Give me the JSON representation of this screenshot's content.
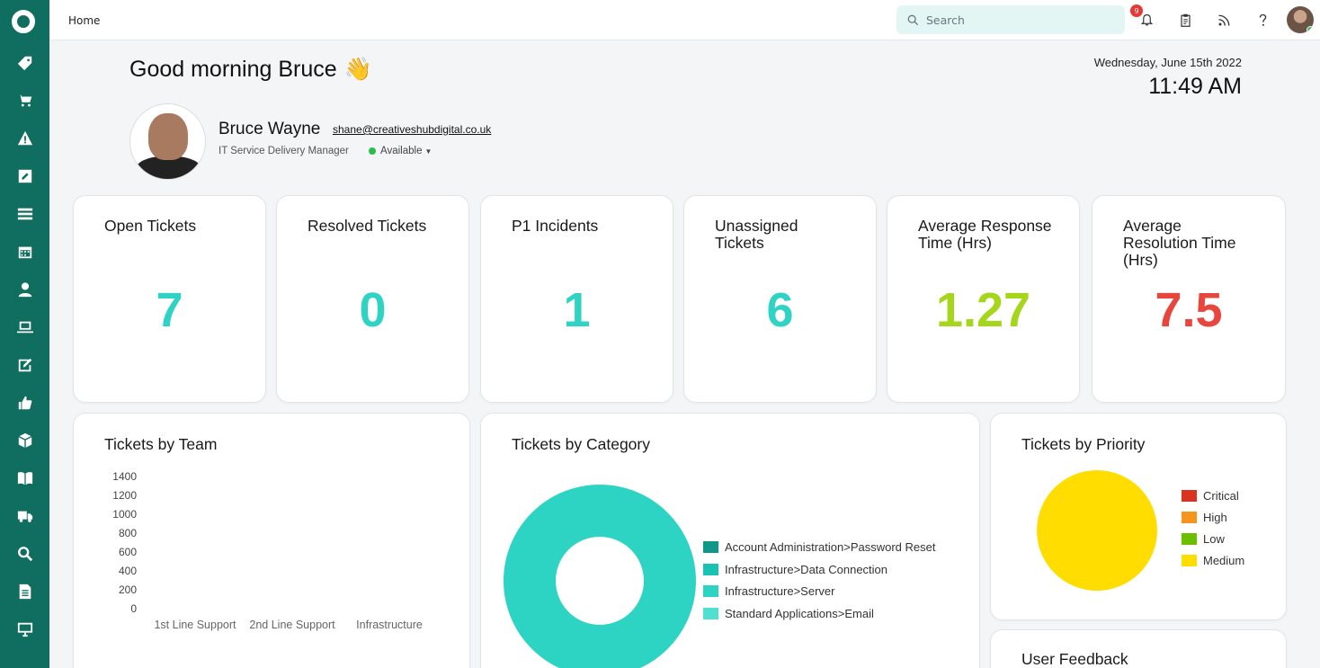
{
  "topbar": {
    "breadcrumb": "Home",
    "search_placeholder": "Search",
    "notifications_count": "9"
  },
  "sidebar": {
    "items": [
      "tag-icon",
      "cart-icon",
      "warning-icon",
      "pencil-box-icon",
      "list-icon",
      "calendar-icon",
      "person-icon",
      "laptop-icon",
      "edit-icon",
      "thumbs-up-icon",
      "box-icon",
      "book-icon",
      "truck-icon",
      "search-icon",
      "document-icon",
      "monitor-icon"
    ]
  },
  "header": {
    "greeting": "Good morning Bruce",
    "wave_emoji": "👋",
    "date": "Wednesday, June 15th 2022",
    "time": "11:49 AM"
  },
  "profile": {
    "name": "Bruce Wayne",
    "email": "shane@creativeshubdigital.co.uk",
    "role": "IT Service Delivery Manager",
    "status": "Available"
  },
  "kpis": [
    {
      "title": "Open Tickets",
      "value": "7",
      "color": "#2fd3c4"
    },
    {
      "title": "Resolved Tickets",
      "value": "0",
      "color": "#2fd3c4"
    },
    {
      "title": "P1 Incidents",
      "value": "1",
      "color": "#2fd3c4"
    },
    {
      "title": "Unassigned Tickets",
      "value": "6",
      "color": "#2fd3c4"
    },
    {
      "title": "Average Response Time (Hrs)",
      "value": "1.27",
      "color": "#a6d61c"
    },
    {
      "title": "Average Resolution Time (Hrs)",
      "value": "7.5",
      "color": "#e8463d"
    }
  ],
  "panels": {
    "team_title": "Tickets by Team",
    "category_title": "Tickets by Category",
    "priority_title": "Tickets by Priority",
    "feedback_title": "User Feedback"
  },
  "chart_data": [
    {
      "type": "bar",
      "title": "Tickets by Team",
      "categories": [
        "1st Line Support",
        "2nd Line Support",
        "Infrastructure"
      ],
      "values": [
        0,
        0,
        0
      ],
      "yticks": [
        "1400",
        "1200",
        "1000",
        "800",
        "600",
        "400",
        "200",
        "0"
      ],
      "ylim": [
        0,
        1400
      ]
    },
    {
      "type": "pie",
      "title": "Tickets by Category",
      "donut": true,
      "labels": [
        "Account Administration>Password Reset",
        "Infrastructure>Data Connection",
        "Infrastructure>Server",
        "Standard Applications>Email"
      ],
      "colors": [
        "#11968a",
        "#19c2b2",
        "#2dd4c4",
        "#4fe0d2"
      ],
      "legend_position": "right"
    },
    {
      "type": "pie",
      "title": "Tickets by Priority",
      "labels": [
        "Critical",
        "High",
        "Low",
        "Medium"
      ],
      "colors": [
        "#d9341f",
        "#f7941d",
        "#6cbf00",
        "#ffdd00"
      ],
      "legend_position": "right"
    }
  ]
}
